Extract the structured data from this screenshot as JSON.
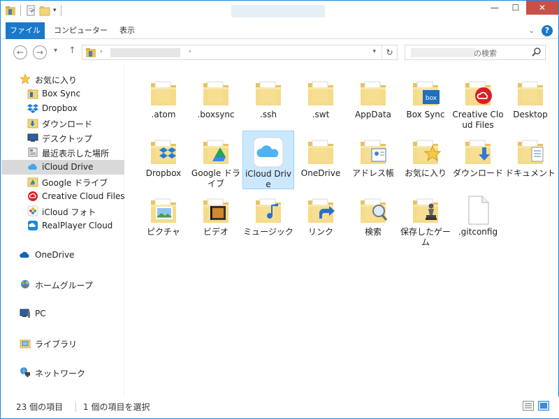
{
  "ribbon": {
    "tabs": [
      "ファイル",
      "コンピューター",
      "表示"
    ]
  },
  "search": {
    "placeholder_suffix": "の検索"
  },
  "sidebar": {
    "favorites": [
      {
        "label": "お気に入り",
        "icon": "star-icon"
      },
      {
        "label": "Box Sync",
        "icon": "folder-icon"
      },
      {
        "label": "Dropbox",
        "icon": "dropbox-icon"
      },
      {
        "label": "ダウンロード",
        "icon": "downloads-icon"
      },
      {
        "label": "デスクトップ",
        "icon": "desktop-icon"
      },
      {
        "label": "最近表示した場所",
        "icon": "recent-places-icon"
      },
      {
        "label": "iCloud Drive",
        "icon": "icloud-icon"
      },
      {
        "label": "Google ドライブ",
        "icon": "google-drive-icon"
      },
      {
        "label": "Creative Cloud Files",
        "icon": "creative-cloud-icon"
      },
      {
        "label": "iCloud フォト",
        "icon": "icloud-photos-icon"
      },
      {
        "label": "RealPlayer Cloud",
        "icon": "realplayer-icon"
      }
    ],
    "sections": [
      {
        "label": "OneDrive",
        "icon": "onedrive-icon"
      },
      {
        "label": "ホームグループ",
        "icon": "homegroup-icon"
      },
      {
        "label": "PC",
        "icon": "pc-icon"
      },
      {
        "label": "ライブラリ",
        "icon": "libraries-icon"
      },
      {
        "label": "ネットワーク",
        "icon": "network-icon"
      }
    ]
  },
  "items": [
    {
      "label": ".atom",
      "icon": "folder-icon"
    },
    {
      "label": ".boxsync",
      "icon": "folder-icon"
    },
    {
      "label": ".ssh",
      "icon": "folder-icon"
    },
    {
      "label": ".swt",
      "icon": "folder-icon"
    },
    {
      "label": "AppData",
      "icon": "folder-icon"
    },
    {
      "label": "Box Sync",
      "icon": "box-folder-icon"
    },
    {
      "label": "Creative Cloud Files",
      "icon": "creative-cloud-folder-icon"
    },
    {
      "label": "Desktop",
      "icon": "folder-icon"
    },
    {
      "label": "Dropbox",
      "icon": "dropbox-folder-icon"
    },
    {
      "label": "Google ドライブ",
      "icon": "google-drive-folder-icon"
    },
    {
      "label": "iCloud Drive",
      "icon": "icloud-drive-icon"
    },
    {
      "label": "OneDrive",
      "icon": "folder-icon"
    },
    {
      "label": "アドレス帳",
      "icon": "contacts-folder-icon"
    },
    {
      "label": "お気に入り",
      "icon": "favorites-folder-icon"
    },
    {
      "label": "ダウンロード",
      "icon": "downloads-folder-icon"
    },
    {
      "label": "ドキュメント",
      "icon": "documents-folder-icon"
    },
    {
      "label": "ピクチャ",
      "icon": "pictures-folder-icon"
    },
    {
      "label": "ビデオ",
      "icon": "videos-folder-icon"
    },
    {
      "label": "ミュージック",
      "icon": "music-folder-icon"
    },
    {
      "label": "リンク",
      "icon": "links-folder-icon"
    },
    {
      "label": "検索",
      "icon": "searches-folder-icon"
    },
    {
      "label": "保存したゲーム",
      "icon": "saved-games-folder-icon"
    },
    {
      "label": ".gitconfig",
      "icon": "file-icon"
    }
  ],
  "selected_item": "iCloud Drive",
  "status": {
    "item_count": "23 個の項目",
    "selection": "1 個の項目を選択"
  },
  "colors": {
    "accent": "#1979ca",
    "selection_bg": "#cce8ff",
    "close_button": "#c7504b",
    "folder": "#f3d57a"
  }
}
